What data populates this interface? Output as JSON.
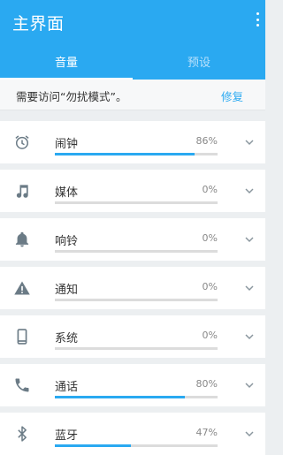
{
  "appbar": {
    "title": "主界面"
  },
  "tabs": [
    {
      "label": "音量",
      "active": true
    },
    {
      "label": "预设",
      "active": false
    }
  ],
  "banner": {
    "message": "需要访问“勿扰模式”。",
    "action": "修复"
  },
  "volumes": [
    {
      "icon": "alarm-icon",
      "label": "闹钟",
      "percent": "86%",
      "level": 0.86
    },
    {
      "icon": "music-note-icon",
      "label": "媒体",
      "percent": "0%",
      "level": 0
    },
    {
      "icon": "bell-icon",
      "label": "响铃",
      "percent": "0%",
      "level": 0
    },
    {
      "icon": "warning-icon",
      "label": "通知",
      "percent": "0%",
      "level": 0
    },
    {
      "icon": "phone-device-icon",
      "label": "系统",
      "percent": "0%",
      "level": 0
    },
    {
      "icon": "call-icon",
      "label": "通话",
      "percent": "80%",
      "level": 0.8
    },
    {
      "icon": "bluetooth-icon",
      "label": "蓝牙",
      "percent": "47%",
      "level": 0.47
    }
  ],
  "colors": {
    "accent": "#2aa9f1",
    "icon": "#6b7b86"
  }
}
